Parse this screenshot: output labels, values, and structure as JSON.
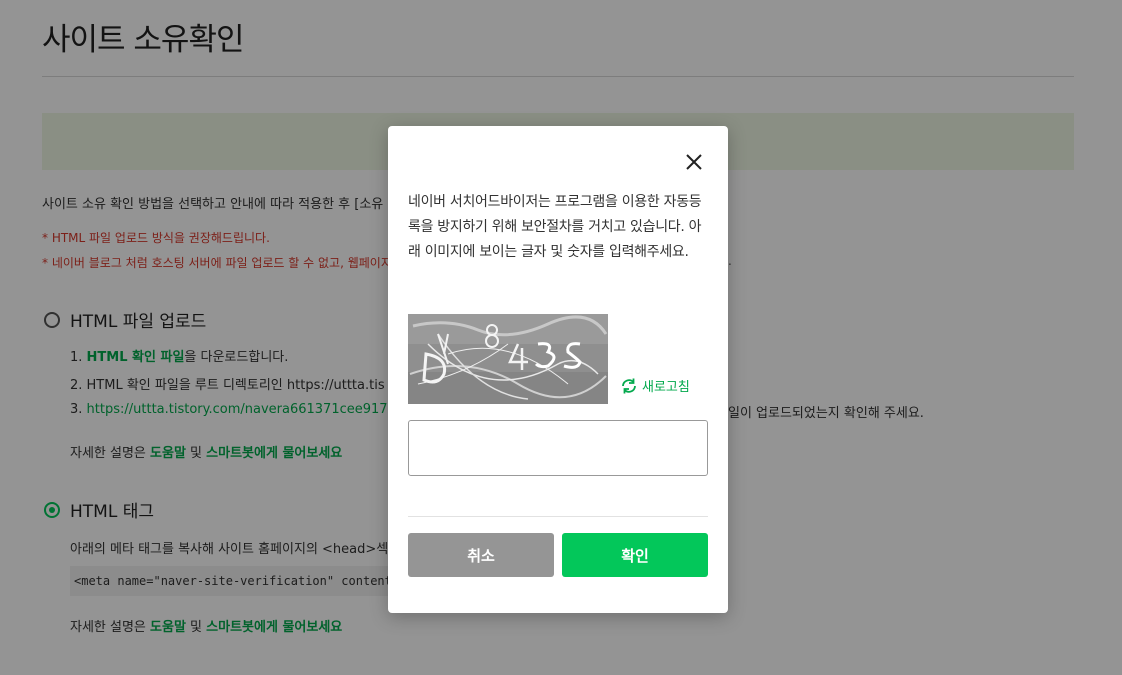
{
  "page": {
    "title": "사이트 소유확인",
    "intro": "사이트 소유 확인 방법을 선택하고 안내에 따라 적용한 후 [소유",
    "notes": [
      "* HTML 파일 업로드 방식을 권장해드립니다.",
      "* 네이버 블로그 처럼 호스팅 서버에 파일 업로드 할 수 없고, 웹페이지"
    ],
    "notes_tail": ".",
    "options": {
      "html_file": {
        "label": "HTML 파일 업로드",
        "selected": false,
        "step1_num": "1. ",
        "step1_link": "HTML 확인 파일",
        "step1_rest": "을 다운로드합니다.",
        "step2": "2. HTML 확인 파일을 루트 디렉토리인 https://uttta.tis",
        "step3_num": "3. ",
        "step3_link": "https://uttta.tistory.com/navera661371cee917",
        "step3_tail": "일이 업로드되었는지 확인해 주세요.",
        "help_prefix": "자세한 설명은 ",
        "help_link1": "도움말",
        "help_mid": " 및 ",
        "help_link2": "스마트봇에게 물어보세요"
      },
      "html_tag": {
        "label": "HTML 태그",
        "selected": true,
        "desc": "아래의 메타 태그를 복사해 사이트 홈페이지의 <head>섹션",
        "code": "<meta name=\"naver-site-verification\" content=\"6",
        "help_prefix": "자세한 설명은 ",
        "help_link1": "도움말",
        "help_mid": " 및 ",
        "help_link2": "스마트봇에게 물어보세요"
      }
    }
  },
  "modal": {
    "message": "네이버 서치어드바이저는 프로그램을 이용한 자동등록을 방지하기 위해 보안절차를 거치고 있습니다. 아래 이미지에 보이는 글자 및 숫자를 입력해주세요.",
    "refresh_label": "새로고침",
    "captcha_input_value": "",
    "cancel_label": "취소",
    "confirm_label": "확인",
    "close_icon": "close-icon",
    "refresh_icon": "refresh-icon"
  },
  "colors": {
    "accent": "#03c75a",
    "link_green": "#03a94d",
    "warning_red": "#d6382c",
    "cancel_gray": "#959595"
  }
}
